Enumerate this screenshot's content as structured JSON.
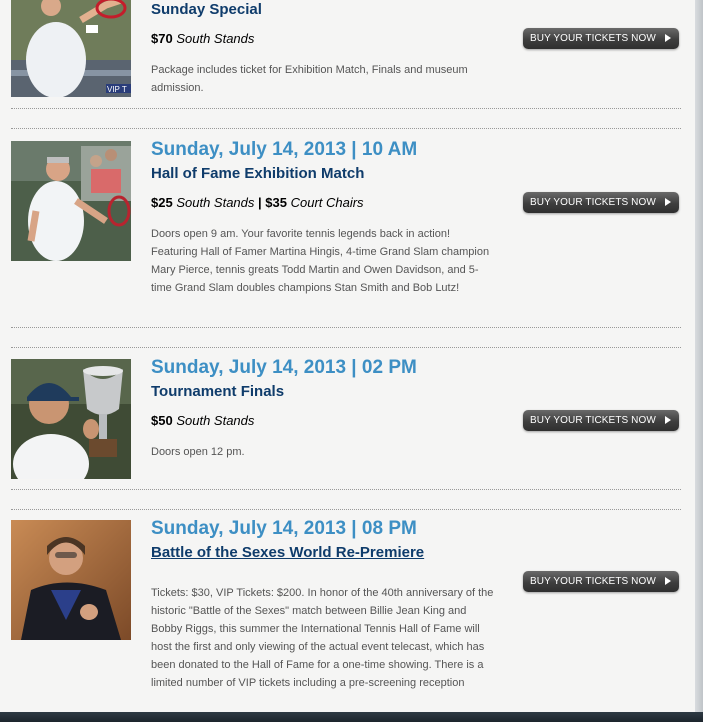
{
  "events": [
    {
      "date": "",
      "title": "Sunday Special",
      "price_amount_1": "$70",
      "price_area_1": "South Stands",
      "description": "Package includes ticket for Exhibition Match, Finals and museum admission.",
      "button_label": "BUY YOUR TICKETS NOW"
    },
    {
      "date": "Sunday, July 14, 2013 | 10 AM",
      "title": "Hall of Fame Exhibition Match",
      "price_amount_1": "$25",
      "price_area_1": "South Stands",
      "price_separator": " | ",
      "price_amount_2": "$35",
      "price_area_2": "Court Chairs",
      "description": "Doors open 9 am. Your favorite tennis legends back in action! Featuring Hall of Famer Martina Hingis, 4-time Grand Slam champion Mary Pierce, tennis greats Todd Martin and Owen Davidson, and 5-time Grand Slam doubles champions Stan Smith and Bob Lutz!",
      "button_label": "BUY YOUR TICKETS NOW"
    },
    {
      "date": "Sunday, July 14, 2013 | 02 PM",
      "title": "Tournament Finals",
      "price_amount_1": "$50",
      "price_area_1": "South Stands",
      "description": "Doors open 12 pm.",
      "button_label": "BUY YOUR TICKETS NOW"
    },
    {
      "date": "Sunday, July 14, 2013 | 08 PM",
      "title": "Battle of the Sexes World Re-Premiere",
      "description": "Tickets: $30, VIP Tickets: $200. In honor of the 40th anniversary of the historic \"Battle of the Sexes\" match between Billie Jean King and Bobby Riggs, this summer the International Tennis Hall of Fame will host the first and only viewing of the actual event telecast, which has been donated to the Hall of Fame for a one-time showing. There is a limited number of VIP tickets including a pre-screening reception",
      "button_label": "BUY YOUR TICKETS NOW"
    }
  ],
  "colors": {
    "date_blue": "#3d8fc4",
    "title_navy": "#0f3c6b",
    "button_dark": "#3e3e3e"
  },
  "icons": {
    "button_arrow": "play-arrow-icon"
  }
}
